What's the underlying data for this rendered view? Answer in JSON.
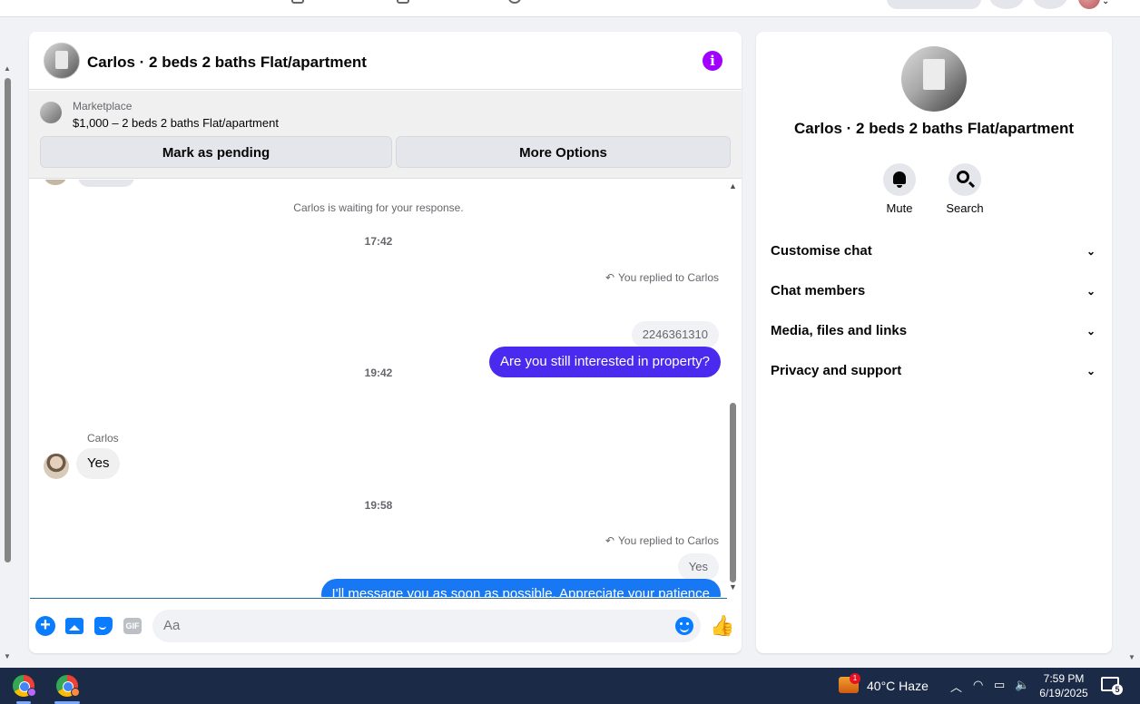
{
  "chat": {
    "title": "Carlos · 2 beds 2 baths Flat/apartment",
    "marketplace": {
      "label": "Marketplace",
      "listing": "$1,000 – 2 beds 2 baths Flat/apartment",
      "pending_button": "Mark as pending",
      "more_button": "More Options"
    },
    "messages": {
      "waiting_note": "Carlos is waiting for your response.",
      "time_1": "17:42",
      "reply_note_1": "You replied to Carlos",
      "quote_1": "2246361310",
      "out_1": "Are you still interested in property?",
      "time_2": "19:42",
      "sender_1": "Carlos",
      "in_1": "Yes",
      "time_3": "19:58",
      "reply_note_2": "You replied to Carlos",
      "quote_2": "Yes",
      "out_2": "I'll message you as soon as possible. Appreciate your patience"
    },
    "composer": {
      "placeholder": "Aa",
      "gif_label": "GIF"
    }
  },
  "info_panel": {
    "name": "Carlos · 2 beds 2 baths Flat/apartment",
    "actions": {
      "mute": "Mute",
      "search": "Search"
    },
    "sections": [
      "Customise chat",
      "Chat members",
      "Media, files and links",
      "Privacy and support"
    ]
  },
  "taskbar": {
    "weather_badge": "1",
    "weather": "40°C  Haze",
    "time": "7:59 PM",
    "date": "6/19/2025",
    "notification_count": "5"
  },
  "colors": {
    "outgoing_bubble": "#1877f2",
    "outgoing_bubble_alt": "#4b2af0",
    "info_icon": "#a100ff",
    "composer_icons": "#0a7cff"
  }
}
